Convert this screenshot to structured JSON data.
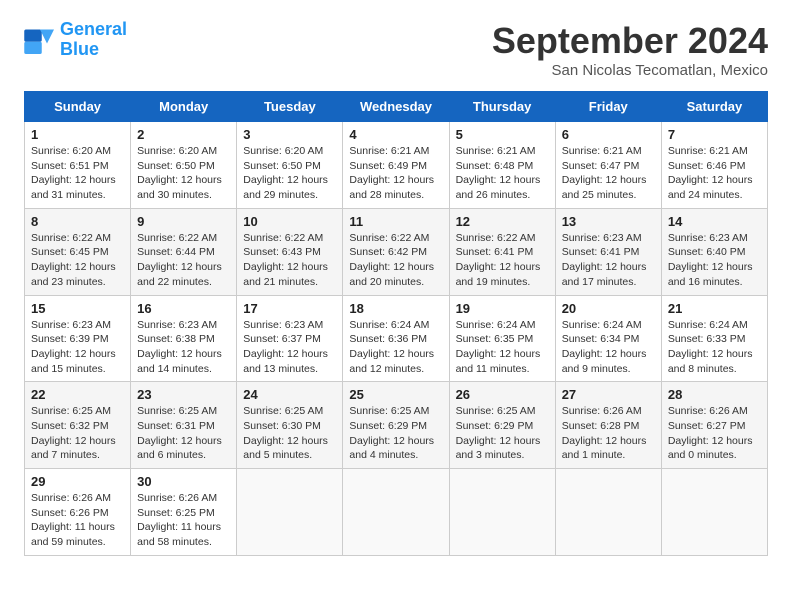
{
  "header": {
    "logo_line1": "General",
    "logo_line2": "Blue",
    "month": "September 2024",
    "location": "San Nicolas Tecomatlan, Mexico"
  },
  "weekdays": [
    "Sunday",
    "Monday",
    "Tuesday",
    "Wednesday",
    "Thursday",
    "Friday",
    "Saturday"
  ],
  "weeks": [
    [
      {
        "day": "1",
        "sunrise": "Sunrise: 6:20 AM",
        "sunset": "Sunset: 6:51 PM",
        "daylight": "Daylight: 12 hours and 31 minutes."
      },
      {
        "day": "2",
        "sunrise": "Sunrise: 6:20 AM",
        "sunset": "Sunset: 6:50 PM",
        "daylight": "Daylight: 12 hours and 30 minutes."
      },
      {
        "day": "3",
        "sunrise": "Sunrise: 6:20 AM",
        "sunset": "Sunset: 6:50 PM",
        "daylight": "Daylight: 12 hours and 29 minutes."
      },
      {
        "day": "4",
        "sunrise": "Sunrise: 6:21 AM",
        "sunset": "Sunset: 6:49 PM",
        "daylight": "Daylight: 12 hours and 28 minutes."
      },
      {
        "day": "5",
        "sunrise": "Sunrise: 6:21 AM",
        "sunset": "Sunset: 6:48 PM",
        "daylight": "Daylight: 12 hours and 26 minutes."
      },
      {
        "day": "6",
        "sunrise": "Sunrise: 6:21 AM",
        "sunset": "Sunset: 6:47 PM",
        "daylight": "Daylight: 12 hours and 25 minutes."
      },
      {
        "day": "7",
        "sunrise": "Sunrise: 6:21 AM",
        "sunset": "Sunset: 6:46 PM",
        "daylight": "Daylight: 12 hours and 24 minutes."
      }
    ],
    [
      {
        "day": "8",
        "sunrise": "Sunrise: 6:22 AM",
        "sunset": "Sunset: 6:45 PM",
        "daylight": "Daylight: 12 hours and 23 minutes."
      },
      {
        "day": "9",
        "sunrise": "Sunrise: 6:22 AM",
        "sunset": "Sunset: 6:44 PM",
        "daylight": "Daylight: 12 hours and 22 minutes."
      },
      {
        "day": "10",
        "sunrise": "Sunrise: 6:22 AM",
        "sunset": "Sunset: 6:43 PM",
        "daylight": "Daylight: 12 hours and 21 minutes."
      },
      {
        "day": "11",
        "sunrise": "Sunrise: 6:22 AM",
        "sunset": "Sunset: 6:42 PM",
        "daylight": "Daylight: 12 hours and 20 minutes."
      },
      {
        "day": "12",
        "sunrise": "Sunrise: 6:22 AM",
        "sunset": "Sunset: 6:41 PM",
        "daylight": "Daylight: 12 hours and 19 minutes."
      },
      {
        "day": "13",
        "sunrise": "Sunrise: 6:23 AM",
        "sunset": "Sunset: 6:41 PM",
        "daylight": "Daylight: 12 hours and 17 minutes."
      },
      {
        "day": "14",
        "sunrise": "Sunrise: 6:23 AM",
        "sunset": "Sunset: 6:40 PM",
        "daylight": "Daylight: 12 hours and 16 minutes."
      }
    ],
    [
      {
        "day": "15",
        "sunrise": "Sunrise: 6:23 AM",
        "sunset": "Sunset: 6:39 PM",
        "daylight": "Daylight: 12 hours and 15 minutes."
      },
      {
        "day": "16",
        "sunrise": "Sunrise: 6:23 AM",
        "sunset": "Sunset: 6:38 PM",
        "daylight": "Daylight: 12 hours and 14 minutes."
      },
      {
        "day": "17",
        "sunrise": "Sunrise: 6:23 AM",
        "sunset": "Sunset: 6:37 PM",
        "daylight": "Daylight: 12 hours and 13 minutes."
      },
      {
        "day": "18",
        "sunrise": "Sunrise: 6:24 AM",
        "sunset": "Sunset: 6:36 PM",
        "daylight": "Daylight: 12 hours and 12 minutes."
      },
      {
        "day": "19",
        "sunrise": "Sunrise: 6:24 AM",
        "sunset": "Sunset: 6:35 PM",
        "daylight": "Daylight: 12 hours and 11 minutes."
      },
      {
        "day": "20",
        "sunrise": "Sunrise: 6:24 AM",
        "sunset": "Sunset: 6:34 PM",
        "daylight": "Daylight: 12 hours and 9 minutes."
      },
      {
        "day": "21",
        "sunrise": "Sunrise: 6:24 AM",
        "sunset": "Sunset: 6:33 PM",
        "daylight": "Daylight: 12 hours and 8 minutes."
      }
    ],
    [
      {
        "day": "22",
        "sunrise": "Sunrise: 6:25 AM",
        "sunset": "Sunset: 6:32 PM",
        "daylight": "Daylight: 12 hours and 7 minutes."
      },
      {
        "day": "23",
        "sunrise": "Sunrise: 6:25 AM",
        "sunset": "Sunset: 6:31 PM",
        "daylight": "Daylight: 12 hours and 6 minutes."
      },
      {
        "day": "24",
        "sunrise": "Sunrise: 6:25 AM",
        "sunset": "Sunset: 6:30 PM",
        "daylight": "Daylight: 12 hours and 5 minutes."
      },
      {
        "day": "25",
        "sunrise": "Sunrise: 6:25 AM",
        "sunset": "Sunset: 6:29 PM",
        "daylight": "Daylight: 12 hours and 4 minutes."
      },
      {
        "day": "26",
        "sunrise": "Sunrise: 6:25 AM",
        "sunset": "Sunset: 6:29 PM",
        "daylight": "Daylight: 12 hours and 3 minutes."
      },
      {
        "day": "27",
        "sunrise": "Sunrise: 6:26 AM",
        "sunset": "Sunset: 6:28 PM",
        "daylight": "Daylight: 12 hours and 1 minute."
      },
      {
        "day": "28",
        "sunrise": "Sunrise: 6:26 AM",
        "sunset": "Sunset: 6:27 PM",
        "daylight": "Daylight: 12 hours and 0 minutes."
      }
    ],
    [
      {
        "day": "29",
        "sunrise": "Sunrise: 6:26 AM",
        "sunset": "Sunset: 6:26 PM",
        "daylight": "Daylight: 11 hours and 59 minutes."
      },
      {
        "day": "30",
        "sunrise": "Sunrise: 6:26 AM",
        "sunset": "Sunset: 6:25 PM",
        "daylight": "Daylight: 11 hours and 58 minutes."
      },
      null,
      null,
      null,
      null,
      null
    ]
  ]
}
